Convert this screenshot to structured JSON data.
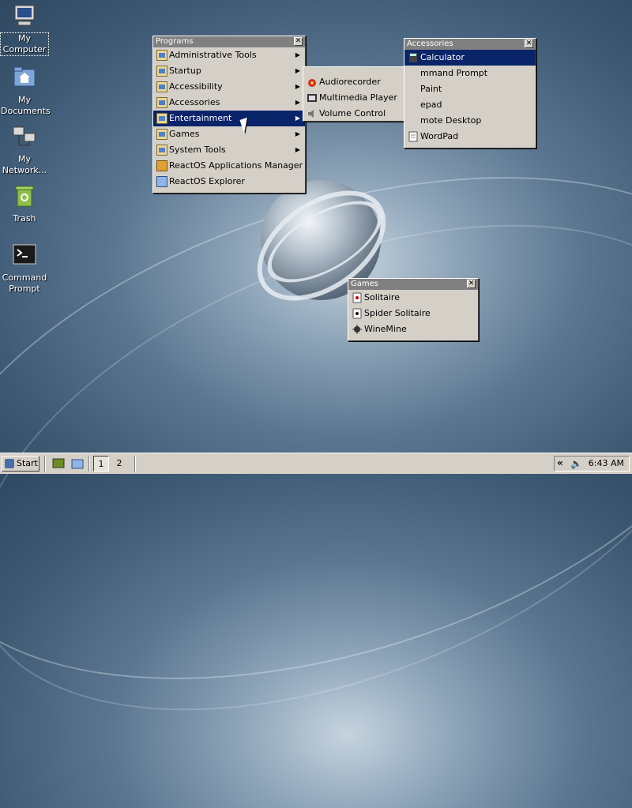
{
  "desktop": {
    "icons": [
      {
        "label": "My Computer",
        "icon": "my-computer-icon"
      },
      {
        "label": "My Documents",
        "icon": "my-documents-icon"
      },
      {
        "label": "My Network...",
        "icon": "my-network-icon"
      },
      {
        "label": "Trash",
        "icon": "trash-icon"
      },
      {
        "label": "Command Prompt",
        "icon": "command-prompt-icon"
      }
    ]
  },
  "programs_menu": {
    "title": "Programs",
    "items": [
      {
        "label": "Administrative Tools",
        "submenu": true
      },
      {
        "label": "Startup",
        "submenu": true
      },
      {
        "label": "Accessibility",
        "submenu": true
      },
      {
        "label": "Accessories",
        "submenu": true
      },
      {
        "label": "Entertainment",
        "submenu": true,
        "highlighted": true
      },
      {
        "label": "Games",
        "submenu": true
      },
      {
        "label": "System Tools",
        "submenu": true
      },
      {
        "label": "ReactOS Applications Manager",
        "submenu": false
      },
      {
        "label": "ReactOS Explorer",
        "submenu": false
      }
    ]
  },
  "entertainment_menu": {
    "items": [
      {
        "label": "Audiorecorder"
      },
      {
        "label": "Multimedia Player"
      },
      {
        "label": "Volume Control"
      }
    ]
  },
  "accessories_menu": {
    "title": "Accessories",
    "items": [
      {
        "label": "Calculator",
        "highlighted": true
      },
      {
        "label": "mmand Prompt"
      },
      {
        "label": "Paint"
      },
      {
        "label": "epad"
      },
      {
        "label": "mote Desktop"
      },
      {
        "label": "WordPad"
      }
    ]
  },
  "games_menu": {
    "title": "Games",
    "items": [
      {
        "label": "Solitaire"
      },
      {
        "label": "Spider Solitaire"
      },
      {
        "label": "WineMine"
      }
    ]
  },
  "taskbar": {
    "start_label": "Start",
    "workspaces": [
      "1",
      "2"
    ],
    "clock": "6:43 AM"
  },
  "colors": {
    "highlight": "#0a246a",
    "panel": "#d4d0c8",
    "title_inactive": "#808080"
  }
}
